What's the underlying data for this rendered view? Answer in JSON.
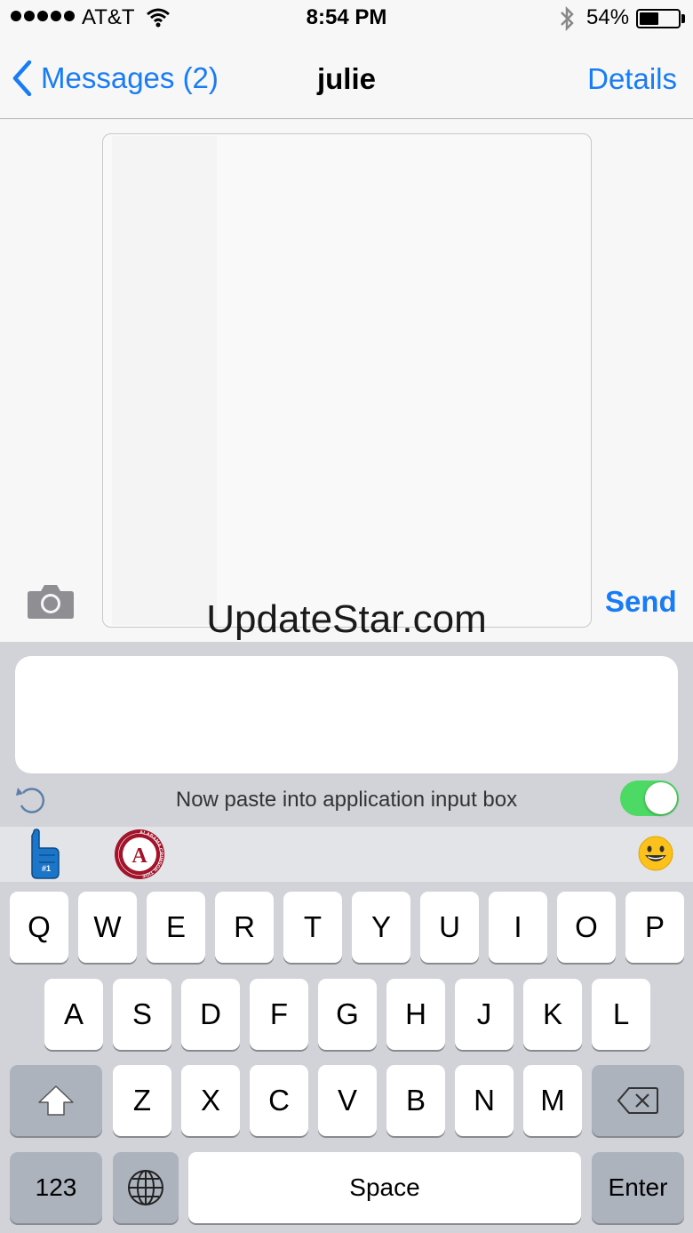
{
  "status_bar": {
    "carrier": "AT&T",
    "time": "8:54 PM",
    "battery": "54%",
    "battery_level": 0.54,
    "icons": [
      "signal-dots-icon",
      "wifi-icon",
      "bluetooth-icon",
      "battery-icon"
    ]
  },
  "nav": {
    "back_label": "Messages (2)",
    "title": "julie",
    "details_label": "Details"
  },
  "compose": {
    "send_label": "Send",
    "camera_icon": "camera-icon"
  },
  "watermark": "UpdateStar.com",
  "keyboard_panel": {
    "paste_instruction": "Now paste into application input box",
    "toggle_on": true,
    "undo_icon": "undo-icon",
    "stickers": [
      "foam-finger-sticker",
      "alabama-crimson-tide-sticker"
    ],
    "emoji_icon": "emoji-icon",
    "sticker_text": {
      "foam_finger": "#1",
      "alabama_letter": "A",
      "alabama_ring": "ALABAMA CRIMSON TIDE"
    }
  },
  "keyboard": {
    "row1": [
      "Q",
      "W",
      "E",
      "R",
      "T",
      "Y",
      "U",
      "I",
      "O",
      "P"
    ],
    "row2": [
      "A",
      "S",
      "D",
      "F",
      "G",
      "H",
      "J",
      "K",
      "L"
    ],
    "row3": [
      "Z",
      "X",
      "C",
      "V",
      "B",
      "N",
      "M"
    ],
    "numbers_label": "123",
    "space_label": "Space",
    "enter_label": "Enter"
  },
  "colors": {
    "accent": "#1a7cf5",
    "toggle": "#4cd964",
    "keyboard_bg": "#d1d3d8",
    "alabama_red": "#a3142a"
  }
}
